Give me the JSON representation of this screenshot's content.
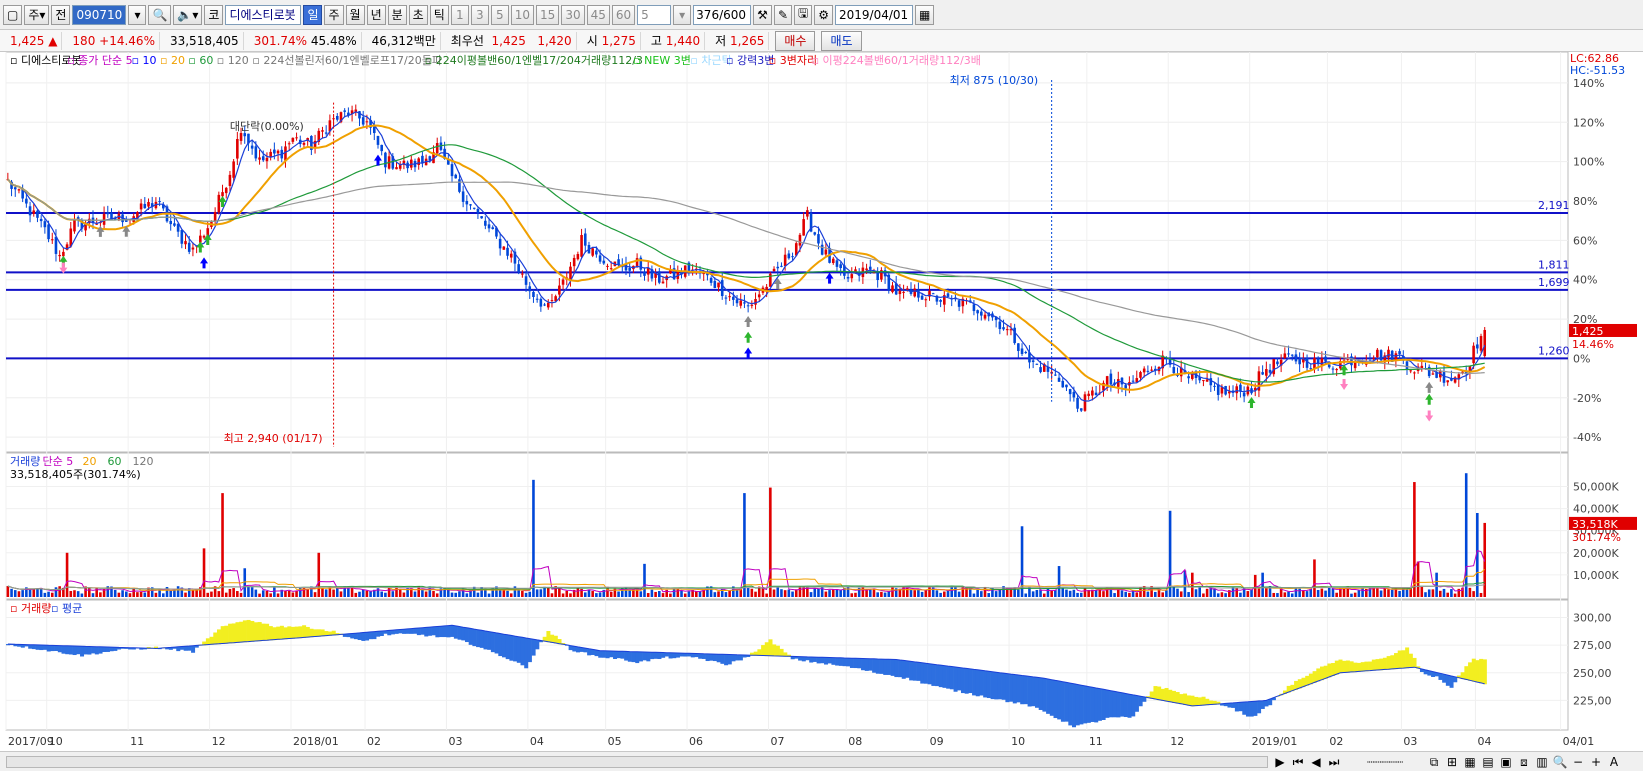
{
  "toolbar": {
    "period_main": "주",
    "all_label": "전",
    "code": "090710",
    "code_short": "코",
    "name": "디에스티로봇",
    "period_tabs": [
      "일",
      "주",
      "월",
      "년",
      "분",
      "초",
      "틱"
    ],
    "active_tab": "일",
    "numbers": [
      "1",
      "3",
      "5",
      "10",
      "15",
      "30",
      "45",
      "60"
    ],
    "count_value": "5",
    "page": "376",
    "page_total": "/600",
    "date": "2019/04/01"
  },
  "quote": {
    "price": "1,425",
    "arrow": "▲",
    "change": "180",
    "change_pct": "+14.46%",
    "volume": "33,518,405",
    "volume_pct": "301.74%",
    "turnover_pct": "45.48%",
    "amount": "46,312백만",
    "pref_label": "최우선",
    "best_bid": "1,425",
    "best_ask": "1,420",
    "open_label": "시",
    "open": "1,275",
    "high_label": "고",
    "high": "1,440",
    "low_label": "저",
    "low": "1,265",
    "buy_label": "매수",
    "sell_label": "매도"
  },
  "colors": {
    "up": "#e00000",
    "down": "#0047d8",
    "ma5": "#1a3fd8",
    "ma20": "#f0a000",
    "ma60": "#1f9a3a",
    "ma120": "#999999",
    "hline": "#1010c8",
    "flat": "#f2ee20"
  },
  "chart_data": [
    {
      "type": "candlestick",
      "panel": "price",
      "legend": [
        {
          "text": "디에스티로봇",
          "color": "#000000"
        },
        {
          "text": "종가 단순 5",
          "color": "#c000c0"
        },
        {
          "text": "10",
          "color": "#0000ff"
        },
        {
          "text": "20",
          "color": "#f0a000"
        },
        {
          "text": "60",
          "color": "#1f9a3a"
        },
        {
          "text": "120",
          "color": "#777777"
        },
        {
          "text": "224선볼린저60/1엔벨로프17/20돌파",
          "color": "#777777"
        },
        {
          "text": "224이평볼밴60/1엔벨17/204거래량112/3",
          "color": "#1f7a1f"
        },
        {
          "text": "NEW 3변",
          "color": "#19c019"
        },
        {
          "text": "차근탁",
          "color": "#9ad8ff"
        },
        {
          "text": "강력3변",
          "color": "#2020c0"
        },
        {
          "text": "3변자리",
          "color": "#e00000"
        },
        {
          "text": "이평224볼밴60/1거래량112/3배",
          "color": "#ff80c0"
        }
      ],
      "right_top": [
        "LC:62.86",
        "HC:-51.53"
      ],
      "y_ticks": [
        "140%",
        "120%",
        "100%",
        "80%",
        "60%",
        "40%",
        "20%",
        "0%",
        "-20%",
        "-40%"
      ],
      "y_tick_values": [
        140,
        120,
        100,
        80,
        60,
        40,
        20,
        0,
        -20,
        -40
      ],
      "ylim": [
        -45,
        143
      ],
      "base_price": 1260,
      "x_months": [
        "2017/09",
        "10",
        "11",
        "12",
        "2018/01",
        "02",
        "03",
        "04",
        "05",
        "06",
        "07",
        "08",
        "09",
        "10",
        "11",
        "12",
        "2019/01",
        "02",
        "03",
        "04",
        "04/01"
      ],
      "x_month_index": [
        0,
        11,
        33,
        55,
        77,
        97,
        119,
        141,
        162,
        184,
        206,
        227,
        249,
        271,
        292,
        314,
        336,
        357,
        377,
        397,
        420
      ],
      "h_levels": [
        {
          "label": "2,191",
          "value": 2191
        },
        {
          "label": "1,811",
          "value": 1811
        },
        {
          "label": "1,699",
          "value": 1699
        },
        {
          "label": "1,260",
          "value": 1260
        }
      ],
      "current_price": "1,425",
      "current_pct": "14.46%",
      "annotations": {
        "high": "최고 2,940 (01/17)",
        "low": "최저 875 (10/30)",
        "note": "대단락(0.00%)"
      },
      "n_bars": 400,
      "anchors": [
        [
          0,
          90
        ],
        [
          10,
          65
        ],
        [
          14,
          52
        ],
        [
          18,
          68
        ],
        [
          24,
          70
        ],
        [
          33,
          72
        ],
        [
          40,
          80
        ],
        [
          45,
          65
        ],
        [
          50,
          55
        ],
        [
          55,
          70
        ],
        [
          60,
          95
        ],
        [
          63,
          118
        ],
        [
          68,
          100
        ],
        [
          74,
          105
        ],
        [
          77,
          112
        ],
        [
          82,
          108
        ],
        [
          87,
          120
        ],
        [
          92,
          125
        ],
        [
          97,
          120
        ],
        [
          102,
          100
        ],
        [
          108,
          98
        ],
        [
          112,
          100
        ],
        [
          116,
          108
        ],
        [
          119,
          95
        ],
        [
          124,
          80
        ],
        [
          130,
          65
        ],
        [
          136,
          52
        ],
        [
          141,
          35
        ],
        [
          146,
          25
        ],
        [
          150,
          38
        ],
        [
          155,
          60
        ],
        [
          160,
          52
        ],
        [
          166,
          45
        ],
        [
          170,
          48
        ],
        [
          175,
          40
        ],
        [
          180,
          42
        ],
        [
          184,
          46
        ],
        [
          190,
          40
        ],
        [
          196,
          30
        ],
        [
          200,
          26
        ],
        [
          206,
          40
        ],
        [
          212,
          55
        ],
        [
          216,
          72
        ],
        [
          220,
          55
        ],
        [
          226,
          40
        ],
        [
          232,
          45
        ],
        [
          236,
          42
        ],
        [
          241,
          32
        ],
        [
          246,
          33
        ],
        [
          252,
          30
        ],
        [
          258,
          28
        ],
        [
          264,
          24
        ],
        [
          268,
          18
        ],
        [
          272,
          10
        ],
        [
          276,
          -2
        ],
        [
          280,
          -5
        ],
        [
          285,
          -12
        ],
        [
          289,
          -25
        ],
        [
          292,
          -20
        ],
        [
          297,
          -12
        ],
        [
          302,
          -15
        ],
        [
          308,
          -5
        ],
        [
          313,
          0
        ],
        [
          318,
          -10
        ],
        [
          324,
          -14
        ],
        [
          330,
          -18
        ],
        [
          336,
          -15
        ],
        [
          340,
          -5
        ],
        [
          346,
          0
        ],
        [
          352,
          -2
        ],
        [
          358,
          -3
        ],
        [
          364,
          0
        ],
        [
          370,
          2
        ],
        [
          376,
          1
        ],
        [
          380,
          -5
        ],
        [
          386,
          -8
        ],
        [
          390,
          -10
        ],
        [
          394,
          -5
        ],
        [
          397,
          8
        ],
        [
          399,
          14.46
        ]
      ],
      "arrows": [
        {
          "i": 15,
          "dir": "up",
          "color": "#2db52d",
          "val": -5
        },
        {
          "i": 15,
          "dir": "down",
          "color": "#ff80c0",
          "val": -8
        },
        {
          "i": 25,
          "dir": "up",
          "color": "#888888",
          "val": -5
        },
        {
          "i": 32,
          "dir": "up",
          "color": "#888888",
          "val": -5
        },
        {
          "i": 52,
          "dir": "up",
          "color": "#2db52d",
          "val": -6
        },
        {
          "i": 54,
          "dir": "up",
          "color": "#2db52d",
          "val": -6
        },
        {
          "i": 53,
          "dir": "up",
          "color": "#0000ff",
          "val": -14
        },
        {
          "i": 58,
          "dir": "up",
          "color": "#2db52d",
          "val": -5
        },
        {
          "i": 100,
          "dir": "up",
          "color": "#0000ff",
          "val": -8
        },
        {
          "i": 200,
          "dir": "up",
          "color": "#888888",
          "val": -8
        },
        {
          "i": 200,
          "dir": "up",
          "color": "#2db52d",
          "val": -16
        },
        {
          "i": 200,
          "dir": "up",
          "color": "#0000ff",
          "val": -24
        },
        {
          "i": 208,
          "dir": "up",
          "color": "#888888",
          "val": -8
        },
        {
          "i": 222,
          "dir": "up",
          "color": "#0000ff",
          "val": -8
        },
        {
          "i": 336,
          "dir": "up",
          "color": "#2db52d",
          "val": -5
        },
        {
          "i": 361,
          "dir": "up",
          "color": "#2db52d",
          "val": -5
        },
        {
          "i": 361,
          "dir": "down",
          "color": "#ff80c0",
          "val": -12
        },
        {
          "i": 384,
          "dir": "up",
          "color": "#888888",
          "val": -6
        },
        {
          "i": 384,
          "dir": "up",
          "color": "#2db52d",
          "val": -12
        },
        {
          "i": 384,
          "dir": "down",
          "color": "#ff80c0",
          "val": -20
        }
      ]
    },
    {
      "type": "bar",
      "panel": "volume",
      "legend": [
        {
          "text": "거래량",
          "color": "#1a3fd8"
        },
        {
          "text": "단순 5",
          "color": "#c000c0"
        },
        {
          "text": "20",
          "color": "#f0a000"
        },
        {
          "text": "60",
          "color": "#1f9a3a"
        },
        {
          "text": "120",
          "color": "#777777"
        }
      ],
      "sub_label": "33,518,405주(301.74%)",
      "y_ticks": [
        "50,000K",
        "40,000K",
        "30,000K",
        "20,000K",
        "10,000K"
      ],
      "y_tick_values": [
        50000,
        40000,
        30000,
        20000,
        10000
      ],
      "ylim": [
        0,
        57000
      ],
      "current": "33,518K",
      "current_pct": "301.74%",
      "spikes": [
        [
          16,
          20000
        ],
        [
          53,
          22000
        ],
        [
          58,
          47000
        ],
        [
          64,
          13000
        ],
        [
          84,
          20000
        ],
        [
          142,
          53000
        ],
        [
          172,
          15000
        ],
        [
          199,
          47000
        ],
        [
          206,
          49500
        ],
        [
          274,
          32000
        ],
        [
          284,
          14000
        ],
        [
          314,
          39000
        ],
        [
          318,
          12000
        ],
        [
          320,
          11000
        ],
        [
          337,
          10000
        ],
        [
          339,
          11000
        ],
        [
          353,
          17000
        ],
        [
          380,
          52000
        ],
        [
          381,
          16000
        ],
        [
          386,
          11000
        ],
        [
          394,
          56000
        ],
        [
          397,
          38000
        ],
        [
          399,
          33518
        ]
      ]
    },
    {
      "type": "area",
      "panel": "volume_avg",
      "legend": [
        {
          "text": "거래량",
          "color": "#e00000"
        },
        {
          "text": "평균",
          "color": "#1a3fd8"
        }
      ],
      "y_ticks": [
        "300,00",
        "275,00",
        "250,00",
        "225,00"
      ],
      "y_tick_values": [
        300,
        275,
        250,
        225
      ],
      "ylim": [
        200,
        305
      ],
      "baseline_anchors": [
        [
          0,
          276
        ],
        [
          40,
          272
        ],
        [
          80,
          282
        ],
        [
          120,
          293
        ],
        [
          160,
          270
        ],
        [
          200,
          266
        ],
        [
          240,
          262
        ],
        [
          280,
          245
        ],
        [
          320,
          220
        ],
        [
          340,
          225
        ],
        [
          360,
          250
        ],
        [
          380,
          255
        ],
        [
          399,
          240
        ]
      ],
      "diff_anchors": [
        [
          0,
          0
        ],
        [
          10,
          -4
        ],
        [
          20,
          -8
        ],
        [
          30,
          -2
        ],
        [
          40,
          1
        ],
        [
          50,
          -5
        ],
        [
          58,
          15
        ],
        [
          65,
          20
        ],
        [
          72,
          12
        ],
        [
          80,
          10
        ],
        [
          88,
          3
        ],
        [
          96,
          -8
        ],
        [
          102,
          -3
        ],
        [
          110,
          -5
        ],
        [
          118,
          -10
        ],
        [
          126,
          -14
        ],
        [
          134,
          -20
        ],
        [
          140,
          -26
        ],
        [
          146,
          10
        ],
        [
          152,
          -3
        ],
        [
          158,
          -5
        ],
        [
          164,
          -6
        ],
        [
          170,
          -9
        ],
        [
          178,
          -4
        ],
        [
          186,
          -3
        ],
        [
          194,
          -9
        ],
        [
          200,
          -1
        ],
        [
          206,
          14
        ],
        [
          212,
          -2
        ],
        [
          220,
          -5
        ],
        [
          228,
          -8
        ],
        [
          236,
          -13
        ],
        [
          244,
          -16
        ],
        [
          252,
          -20
        ],
        [
          260,
          -22
        ],
        [
          268,
          -24
        ],
        [
          276,
          -26
        ],
        [
          282,
          -32
        ],
        [
          288,
          -38
        ],
        [
          292,
          -33
        ],
        [
          298,
          -24
        ],
        [
          304,
          -20
        ],
        [
          310,
          12
        ],
        [
          316,
          10
        ],
        [
          322,
          8
        ],
        [
          330,
          -3
        ],
        [
          336,
          -14
        ],
        [
          340,
          -6
        ],
        [
          346,
          5
        ],
        [
          352,
          10
        ],
        [
          358,
          12
        ],
        [
          366,
          8
        ],
        [
          372,
          10
        ],
        [
          378,
          18
        ],
        [
          382,
          -3
        ],
        [
          386,
          -4
        ],
        [
          390,
          -10
        ],
        [
          394,
          12
        ],
        [
          396,
          20
        ],
        [
          399,
          22
        ]
      ]
    }
  ]
}
